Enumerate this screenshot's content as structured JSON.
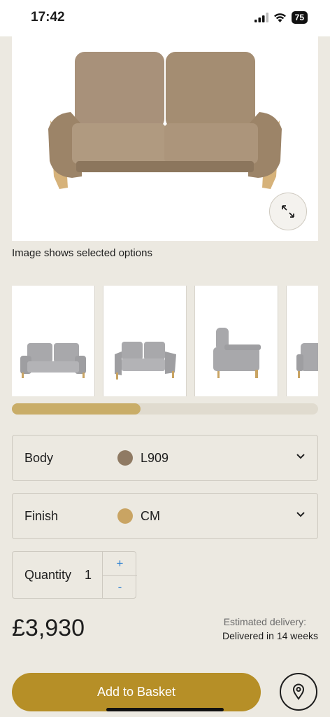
{
  "status_bar": {
    "time": "17:42",
    "battery": "75"
  },
  "gallery": {
    "caption": "Image shows selected options",
    "scroll_progress": 0.42
  },
  "options": [
    {
      "label": "Body",
      "value": "L909",
      "swatch_color": "#8f7a63"
    },
    {
      "label": "Finish",
      "value": "CM",
      "swatch_color": "#c9a463"
    }
  ],
  "quantity": {
    "label": "Quantity",
    "value": "1",
    "plus": "+",
    "minus": "-"
  },
  "price": "£3,930",
  "delivery": {
    "label": "Estimated delivery:",
    "value": "Delivered in 14 weeks"
  },
  "actions": {
    "add_to_basket": "Add to Basket"
  },
  "colors": {
    "accent": "#b68f27",
    "background": "#ece9e1",
    "scroll_fill": "#c9ad68",
    "sofa_body": "#a48d72",
    "sofa_grey": "#a8a8ab",
    "wood": "#c9a463",
    "link_blue": "#2a7fd1"
  },
  "icons": [
    "signal-icon",
    "wifi-icon",
    "battery-icon",
    "expand-icon",
    "chevron-down-icon",
    "location-pin-icon"
  ]
}
